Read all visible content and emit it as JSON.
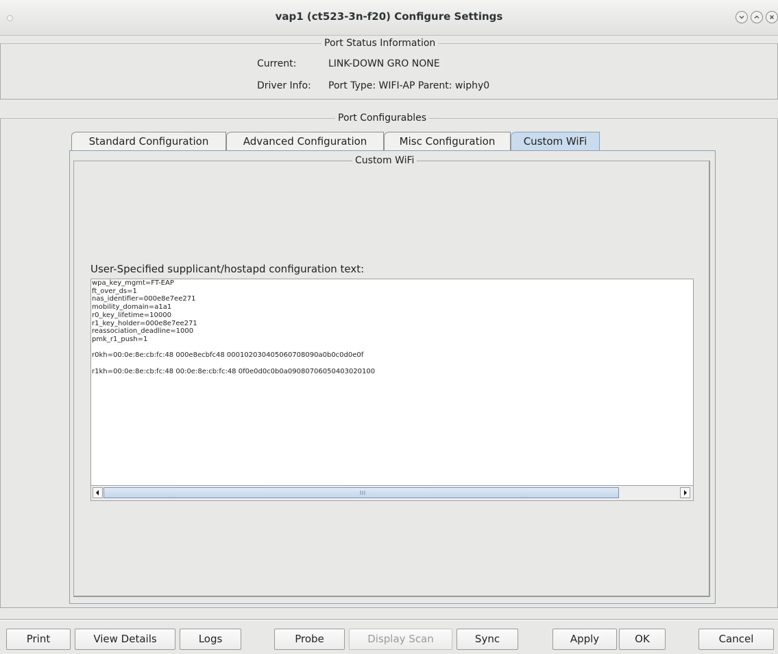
{
  "window": {
    "title": "vap1  (ct523-3n-f20) Configure Settings"
  },
  "port_status": {
    "title": "Port Status Information",
    "current_label": "Current:",
    "current_value": "LINK-DOWN GRO  NONE",
    "driver_label": "Driver Info:",
    "driver_value": "Port Type: WIFI-AP   Parent: wiphy0"
  },
  "configurables": {
    "title": "Port Configurables",
    "tabs": [
      {
        "label": "Standard Configuration",
        "active": false
      },
      {
        "label": "Advanced Configuration",
        "active": false
      },
      {
        "label": "Misc Configuration",
        "active": false
      },
      {
        "label": "Custom WiFi",
        "active": true
      }
    ]
  },
  "custom_wifi": {
    "title": "Custom WiFi",
    "text_label": "User-Specified supplicant/hostapd configuration text:",
    "text_lines": [
      "wpa_key_mgmt=FT-EAP",
      "ft_over_ds=1",
      "nas_identifier=000e8e7ee271",
      "mobility_domain=a1a1",
      "r0_key_lifetime=10000",
      "r1_key_holder=000e8e7ee271",
      "reassociation_deadline=1000",
      "pmk_r1_push=1",
      "",
      "r0kh=00:0e:8e:cb:fc:48 000e8ecbfc48 000102030405060708090a0b0c0d0e0f",
      "",
      "r1kh=00:0e:8e:cb:fc:48 00:0e:8e:cb:fc:48 0f0e0d0c0b0a09080706050403020100"
    ]
  },
  "buttons": {
    "print": "Print",
    "view_details": "View Details",
    "logs": "Logs",
    "probe": "Probe",
    "display_scan": "Display Scan",
    "sync": "Sync",
    "apply": "Apply",
    "ok": "OK",
    "cancel": "Cancel"
  },
  "icons": {
    "window_menu": "window-menu-dot-icon",
    "minimize": "chevron-down-icon",
    "maximize": "chevron-up-icon",
    "close": "close-icon",
    "scroll_left": "triangle-left-icon",
    "scroll_right": "triangle-right-icon"
  },
  "colors": {
    "active_tab": "#c9dcee",
    "background": "#e8e8e7",
    "text_area": "#ffffff",
    "scroll_thumb": "#c4d6ea"
  }
}
